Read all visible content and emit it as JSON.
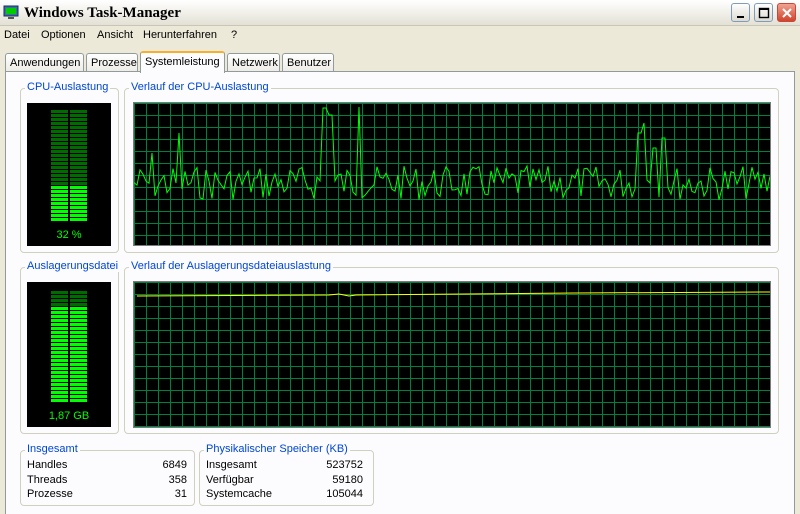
{
  "window": {
    "title": "Windows Task-Manager"
  },
  "menu": [
    "Datei",
    "Optionen",
    "Ansicht",
    "Herunterfahren",
    "?"
  ],
  "tabs": [
    "Anwendungen",
    "Prozesse",
    "Systemleistung",
    "Netzwerk",
    "Benutzer"
  ],
  "active_tab": "Systemleistung",
  "cpu": {
    "meter_title": "CPU-Auslastung",
    "meter_label": "32 %",
    "usage_percent": 32,
    "history_title": "Verlauf der CPU-Auslastung"
  },
  "pagefile": {
    "meter_title": "Auslagerungsdatei",
    "meter_label": "1,87 GB",
    "usage_fraction": 0.87,
    "history_title": "Verlauf der Auslagerungsdateiauslastung"
  },
  "totals": {
    "title": "Insgesamt",
    "rows": [
      {
        "label": "Handles",
        "value": "6849"
      },
      {
        "label": "Threads",
        "value": "358"
      },
      {
        "label": "Prozesse",
        "value": "31"
      }
    ]
  },
  "physical_memory": {
    "title": "Physikalischer Speicher (KB)",
    "rows": [
      {
        "label": "Insgesamt",
        "value": "523752"
      },
      {
        "label": "Verfügbar",
        "value": "59180"
      },
      {
        "label": "Systemcache",
        "value": "105044"
      }
    ]
  },
  "colors": {
    "graph_green": "#00ff00",
    "grid": "#008040",
    "pagefile_line": "#ffff00",
    "accent_blue": "#0046d5"
  }
}
